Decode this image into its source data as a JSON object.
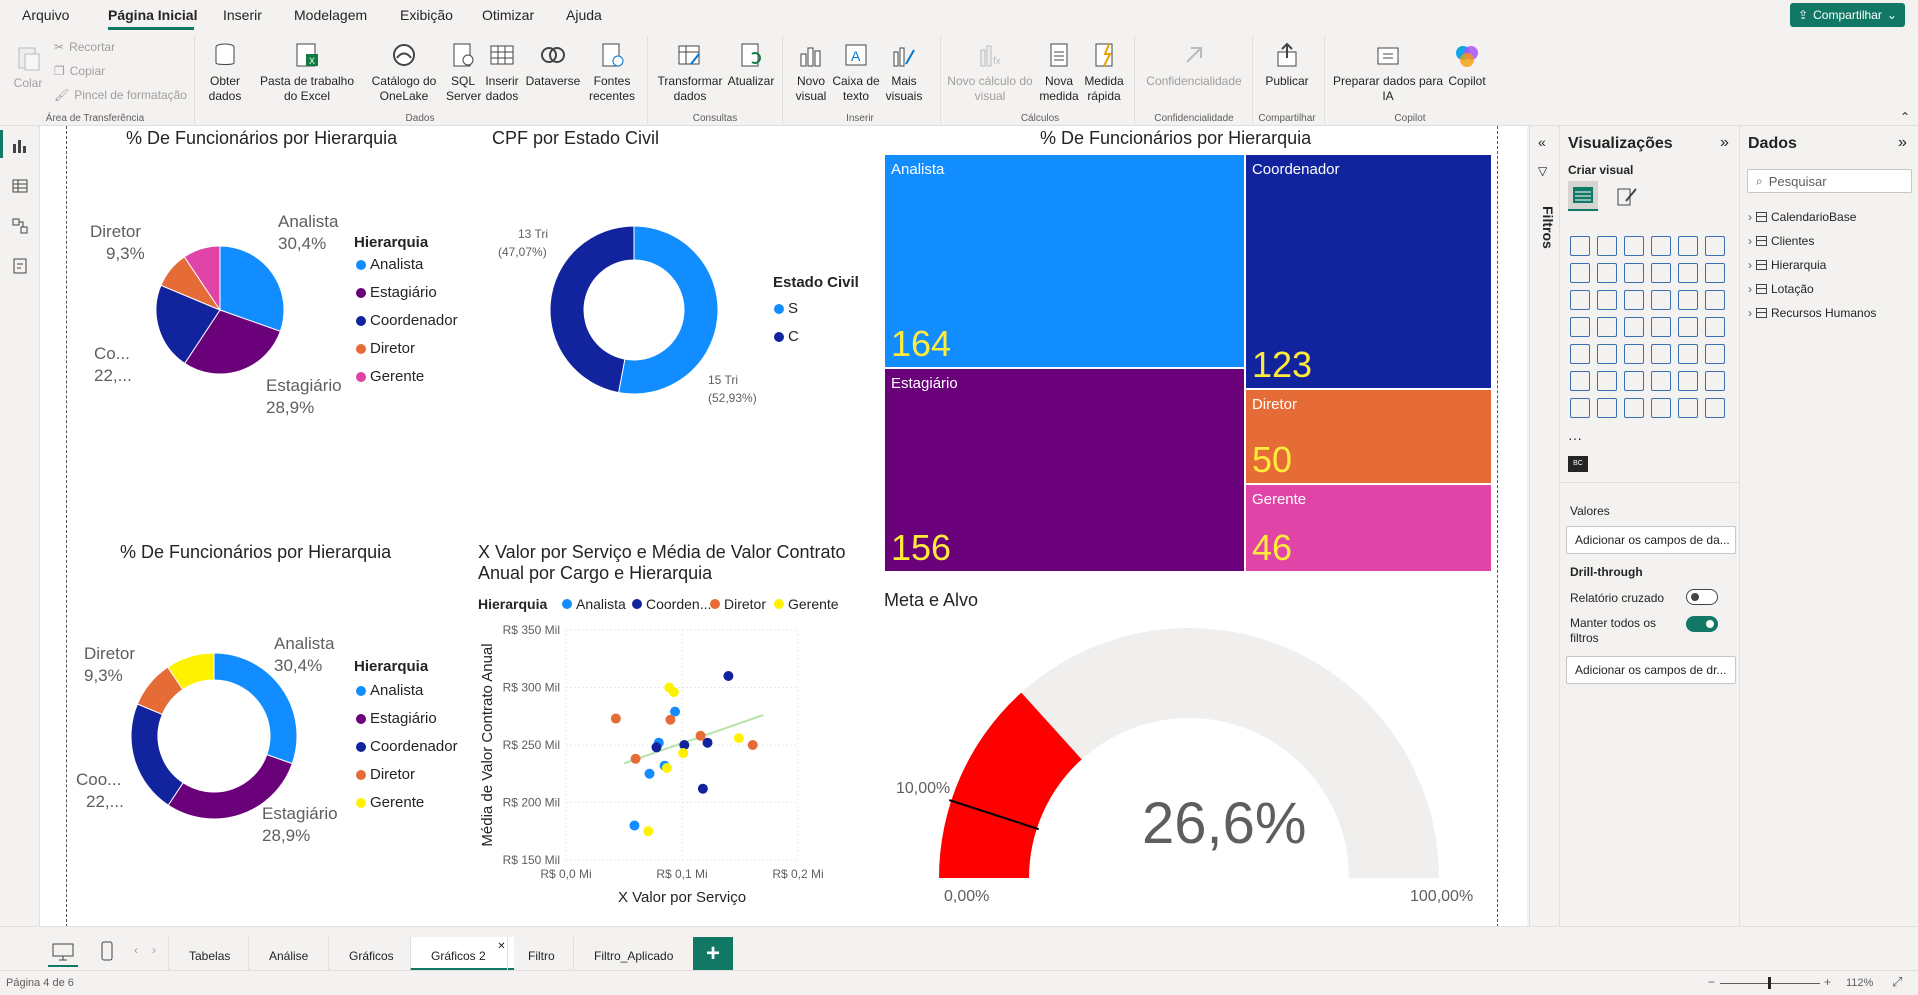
{
  "menu": [
    "Arquivo",
    "Página Inicial",
    "Inserir",
    "Modelagem",
    "Exibição",
    "Otimizar",
    "Ajuda"
  ],
  "share_label": "Compartilhar",
  "ribbon": {
    "clipboard": {
      "colar": "Colar",
      "recortar": "Recortar",
      "copiar": "Copiar",
      "pincel": "Pincel de formatação",
      "group": "Área de Transferência"
    },
    "dados": {
      "obter": "Obter dados",
      "excel": "Pasta de trabalho do Excel",
      "onelake": "Catálogo do OneLake",
      "sql": "SQL Server",
      "inserir": "Inserir dados",
      "dataverse": "Dataverse",
      "fontes": "Fontes recentes",
      "group": "Dados"
    },
    "consultas": {
      "transformar": "Transformar dados",
      "atualizar": "Atualizar",
      "group": "Consultas"
    },
    "inserir": {
      "novo_visual": "Novo visual",
      "caixa_texto": "Caixa de texto",
      "mais_visuais": "Mais visuais",
      "group": "Inserir"
    },
    "calculos": {
      "novo_calculo": "Novo cálculo do visual",
      "nova_medida": "Nova medida",
      "medida_rapida": "Medida rápida",
      "group": "Cálculos"
    },
    "confidencialidade": {
      "label": "Confidencialidade",
      "group": "Confidencialidade"
    },
    "compartilhar": {
      "publicar": "Publicar",
      "group": "Compartilhar"
    },
    "copilot": {
      "preparar": "Preparar dados para IA",
      "copilot": "Copilot",
      "group": "Copilot"
    }
  },
  "visuals": {
    "pie1": {
      "title": "% De Funcionários por Hierarquia",
      "legend_title": "Hierarquia",
      "labels": [
        "Analista",
        "30,4%",
        "Diretor",
        "9,3%",
        "Co...",
        "22,...",
        "Estagiário",
        "28,9%"
      ]
    },
    "donut_cpf": {
      "title": "CPF por Estado Civil",
      "legend_title": "Estado Civil",
      "legend": [
        "S",
        "C"
      ],
      "labels": [
        "13 Tri",
        "(47,07%)",
        "15 Tri",
        "(52,93%)"
      ]
    },
    "treemap": {
      "title": "% De Funcionários por Hierarquia"
    },
    "pie2": {
      "title": "% De Funcionários por Hierarquia",
      "legend_title": "Hierarquia",
      "labels": [
        "Analista",
        "30,4%",
        "Diretor",
        "9,3%",
        "Coo...",
        "22,...",
        "Estagiário",
        "28,9%"
      ]
    },
    "scatter": {
      "title": "X Valor por Serviço e Média de Valor Contrato Anual por Cargo e Hierarquia",
      "legend_title": "Hierarquia",
      "legend": [
        "Analista",
        "Coorden...",
        "Diretor",
        "Gerente"
      ]
    },
    "gauge": {
      "title": "Meta e Alvo",
      "value": "26,6%",
      "target": "10,00%",
      "min": "0,00%",
      "max": "100,00%"
    }
  },
  "chart_data": [
    {
      "type": "pie",
      "title": "% De Funcionários por Hierarquia",
      "legend_title": "Hierarquia",
      "categories": [
        "Analista",
        "Estagiário",
        "Coordenador",
        "Diretor",
        "Gerente"
      ],
      "values": [
        30.4,
        28.9,
        22.0,
        9.3,
        9.4
      ],
      "colors": [
        "#118dff",
        "#6b007b",
        "#12239e",
        "#e66c37",
        "#e044a7"
      ]
    },
    {
      "type": "pie",
      "title": "CPF por Estado Civil",
      "legend_title": "Estado Civil",
      "categories": [
        "S",
        "C"
      ],
      "values": [
        52.93,
        47.07
      ],
      "colors": [
        "#118dff",
        "#12239e"
      ]
    },
    {
      "type": "treemap",
      "title": "% De Funcionários por Hierarquia",
      "categories": [
        "Analista",
        "Estagiário",
        "Coordenador",
        "Diretor",
        "Gerente"
      ],
      "values": [
        164,
        156,
        123,
        50,
        46
      ],
      "colors": [
        "#118dff",
        "#6b007b",
        "#12239e",
        "#e66c37",
        "#e044a7"
      ]
    },
    {
      "type": "pie",
      "title": "% De Funcionários por Hierarquia",
      "legend_title": "Hierarquia",
      "categories": [
        "Analista",
        "Estagiário",
        "Coordenador",
        "Diretor",
        "Gerente"
      ],
      "values": [
        30.4,
        28.9,
        22.0,
        9.3,
        9.4
      ],
      "colors": [
        "#118dff",
        "#6b007b",
        "#12239e",
        "#e66c37",
        "#fff200"
      ]
    },
    {
      "type": "scatter",
      "title": "X Valor por Serviço e Média de Valor Contrato Anual por Cargo e Hierarquia",
      "xlabel": "X Valor por Serviço",
      "ylabel": "Média de Valor Contrato Anual",
      "xticks": [
        "R$ 0,0 Mi",
        "R$ 0,1 Mi",
        "R$ 0,2 Mi"
      ],
      "yticks": [
        "R$ 350 Mil",
        "R$ 300 Mil",
        "R$ 250 Mil",
        "R$ 200 Mil",
        "R$ 150 Mil"
      ],
      "xlim": [
        0,
        0.2
      ],
      "ylim": [
        150,
        350
      ],
      "series": [
        {
          "name": "Analista",
          "color": "#118dff",
          "points": [
            [
              0.08,
              252
            ],
            [
              0.085,
              232
            ],
            [
              0.094,
              279
            ],
            [
              0.072,
              225
            ],
            [
              0.059,
              180
            ]
          ]
        },
        {
          "name": "Coorden...",
          "color": "#12239e",
          "points": [
            [
              0.14,
              310
            ],
            [
              0.122,
              252
            ],
            [
              0.102,
              250
            ],
            [
              0.078,
              248
            ],
            [
              0.118,
              212
            ]
          ]
        },
        {
          "name": "Diretor",
          "color": "#e66c37",
          "points": [
            [
              0.043,
              273
            ],
            [
              0.09,
              272
            ],
            [
              0.116,
              258
            ],
            [
              0.161,
              250
            ],
            [
              0.06,
              238
            ]
          ]
        },
        {
          "name": "Gerente",
          "color": "#fff200",
          "points": [
            [
              0.089,
              300
            ],
            [
              0.093,
              296
            ],
            [
              0.101,
              243
            ],
            [
              0.087,
              230
            ],
            [
              0.071,
              175
            ],
            [
              0.149,
              256
            ]
          ]
        }
      ]
    },
    {
      "type": "gauge",
      "title": "Meta e Alvo",
      "value": 26.6,
      "target": 10,
      "min": 0,
      "max": 100,
      "fill": "#ff0000"
    }
  ],
  "panes": {
    "filters": "Filtros",
    "viz": {
      "title": "Visualizações",
      "criar": "Criar visual",
      "valores": "Valores",
      "valores_drop": "Adicionar os campos de da...",
      "drill": "Drill-through",
      "cruzado": "Relatório cruzado",
      "manter": "Manter todos os filtros",
      "drill_drop": "Adicionar os campos de dr..."
    },
    "dados": {
      "title": "Dados",
      "search_placeholder": "Pesquisar",
      "tables": [
        "CalendarioBase",
        "Clientes",
        "Hierarquia",
        "Lotação",
        "Recursos Humanos"
      ]
    }
  },
  "tabs": [
    "Tabelas",
    "Análise",
    "Gráficos",
    "Gráficos 2",
    "Filtro",
    "Filtro_Aplicado"
  ],
  "status": {
    "page": "Página 4 de 6",
    "zoom": "112%"
  }
}
